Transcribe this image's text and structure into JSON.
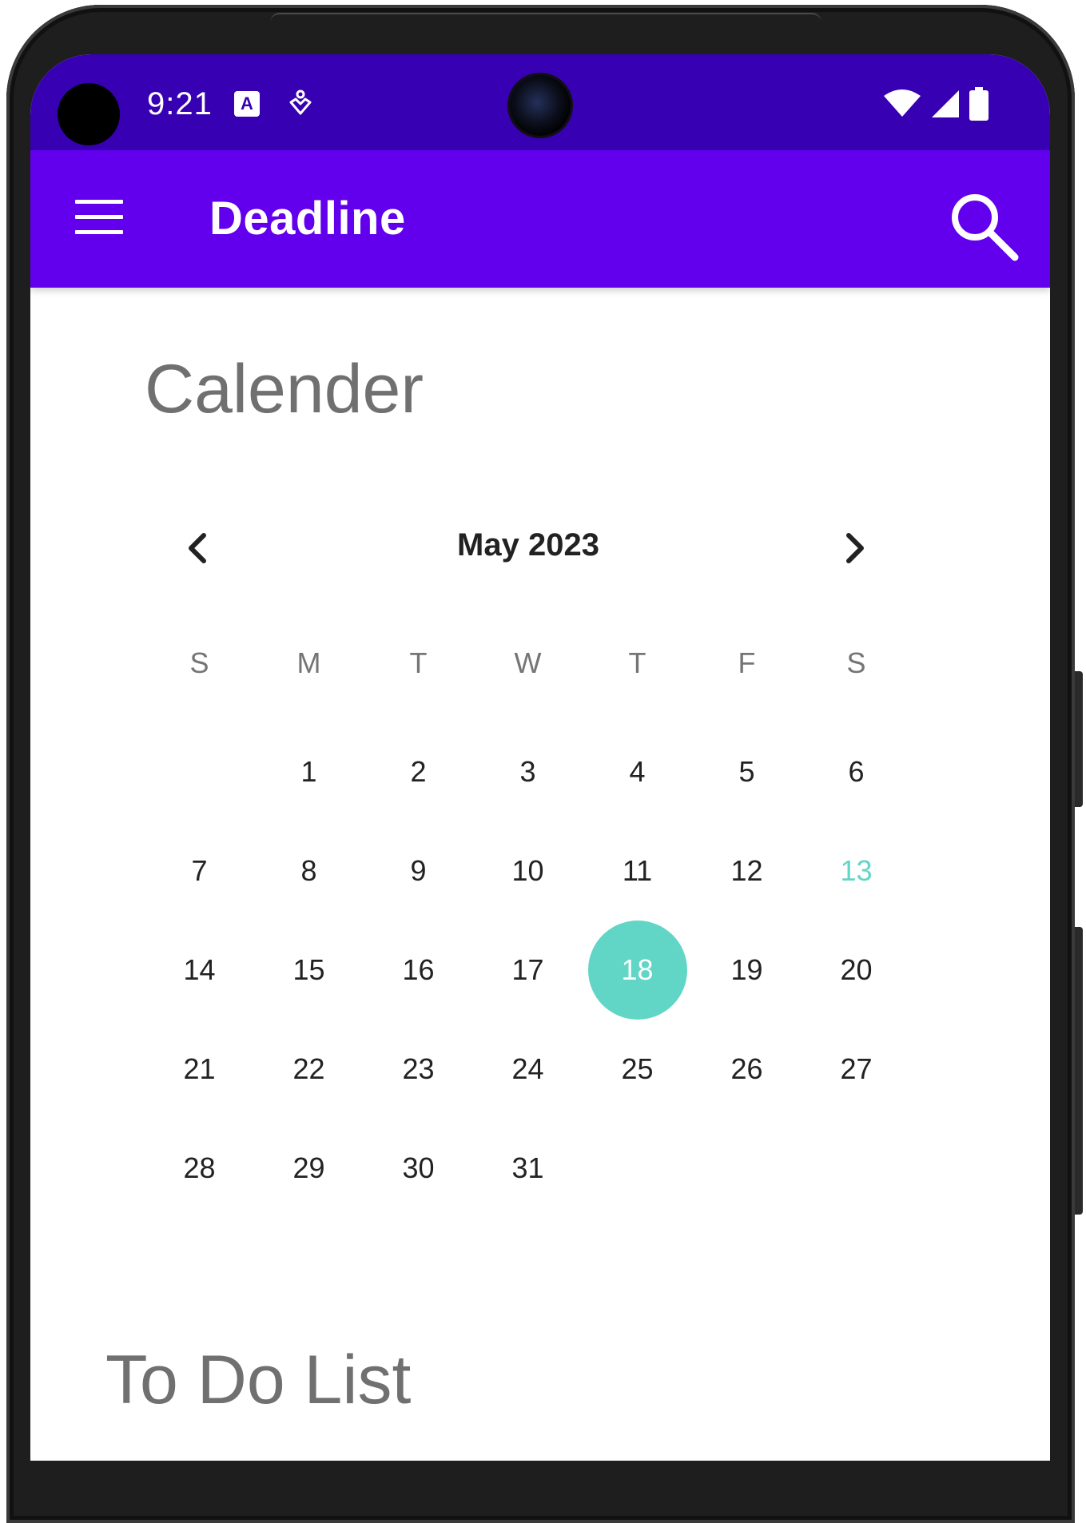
{
  "status_bar": {
    "time": "9:21",
    "notification_letter": "A"
  },
  "app_bar": {
    "title": "Deadline"
  },
  "sections": {
    "calendar_title": "Calender",
    "todo_title": "To Do List"
  },
  "calendar": {
    "month_label": "May 2023",
    "weekdays": [
      "S",
      "M",
      "T",
      "W",
      "T",
      "F",
      "S"
    ],
    "leading_blanks": 1,
    "days": [
      "1",
      "2",
      "3",
      "4",
      "5",
      "6",
      "7",
      "8",
      "9",
      "10",
      "11",
      "12",
      "13",
      "14",
      "15",
      "16",
      "17",
      "18",
      "19",
      "20",
      "21",
      "22",
      "23",
      "24",
      "25",
      "26",
      "27",
      "28",
      "29",
      "30",
      "31"
    ],
    "today": "13",
    "selected": "18"
  },
  "colors": {
    "status_bar": "#3700b3",
    "app_bar": "#6200ee",
    "accent_teal": "#62d6c6",
    "section_title": "#707070"
  }
}
